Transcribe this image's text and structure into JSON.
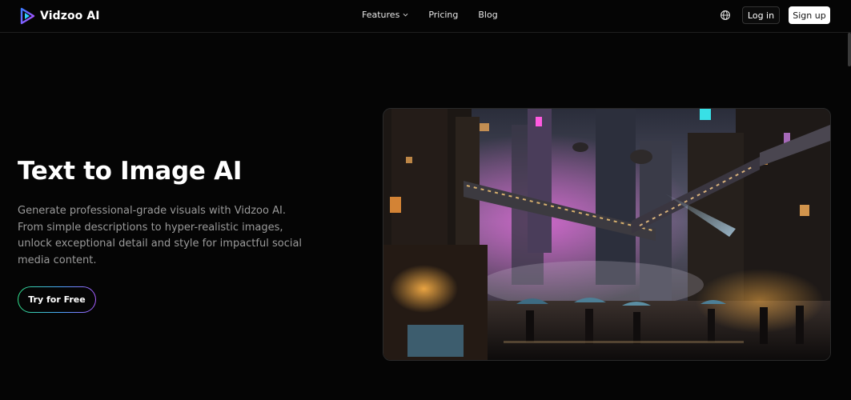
{
  "header": {
    "brand": "Vidzoo AI",
    "nav": {
      "features": "Features",
      "pricing": "Pricing",
      "blog": "Blog"
    },
    "login": "Log in",
    "signup": "Sign up"
  },
  "hero": {
    "title": "Text to Image AI",
    "description": "Generate professional-grade visuals with Vidzoo AI. From simple descriptions to hyper-realistic images, unlock exceptional detail and style for impactful social media content.",
    "cta": "Try for Free"
  },
  "colors": {
    "background": "#050505",
    "text_muted": "#9a9a9a",
    "cta_gradient": [
      "#2fe08a",
      "#4aa6ff",
      "#a85bff"
    ],
    "signup_bg": "#ffffff"
  },
  "icons": {
    "logo": "vidzoo-play-logo",
    "features_dropdown": "chevron-down",
    "language": "globe"
  }
}
